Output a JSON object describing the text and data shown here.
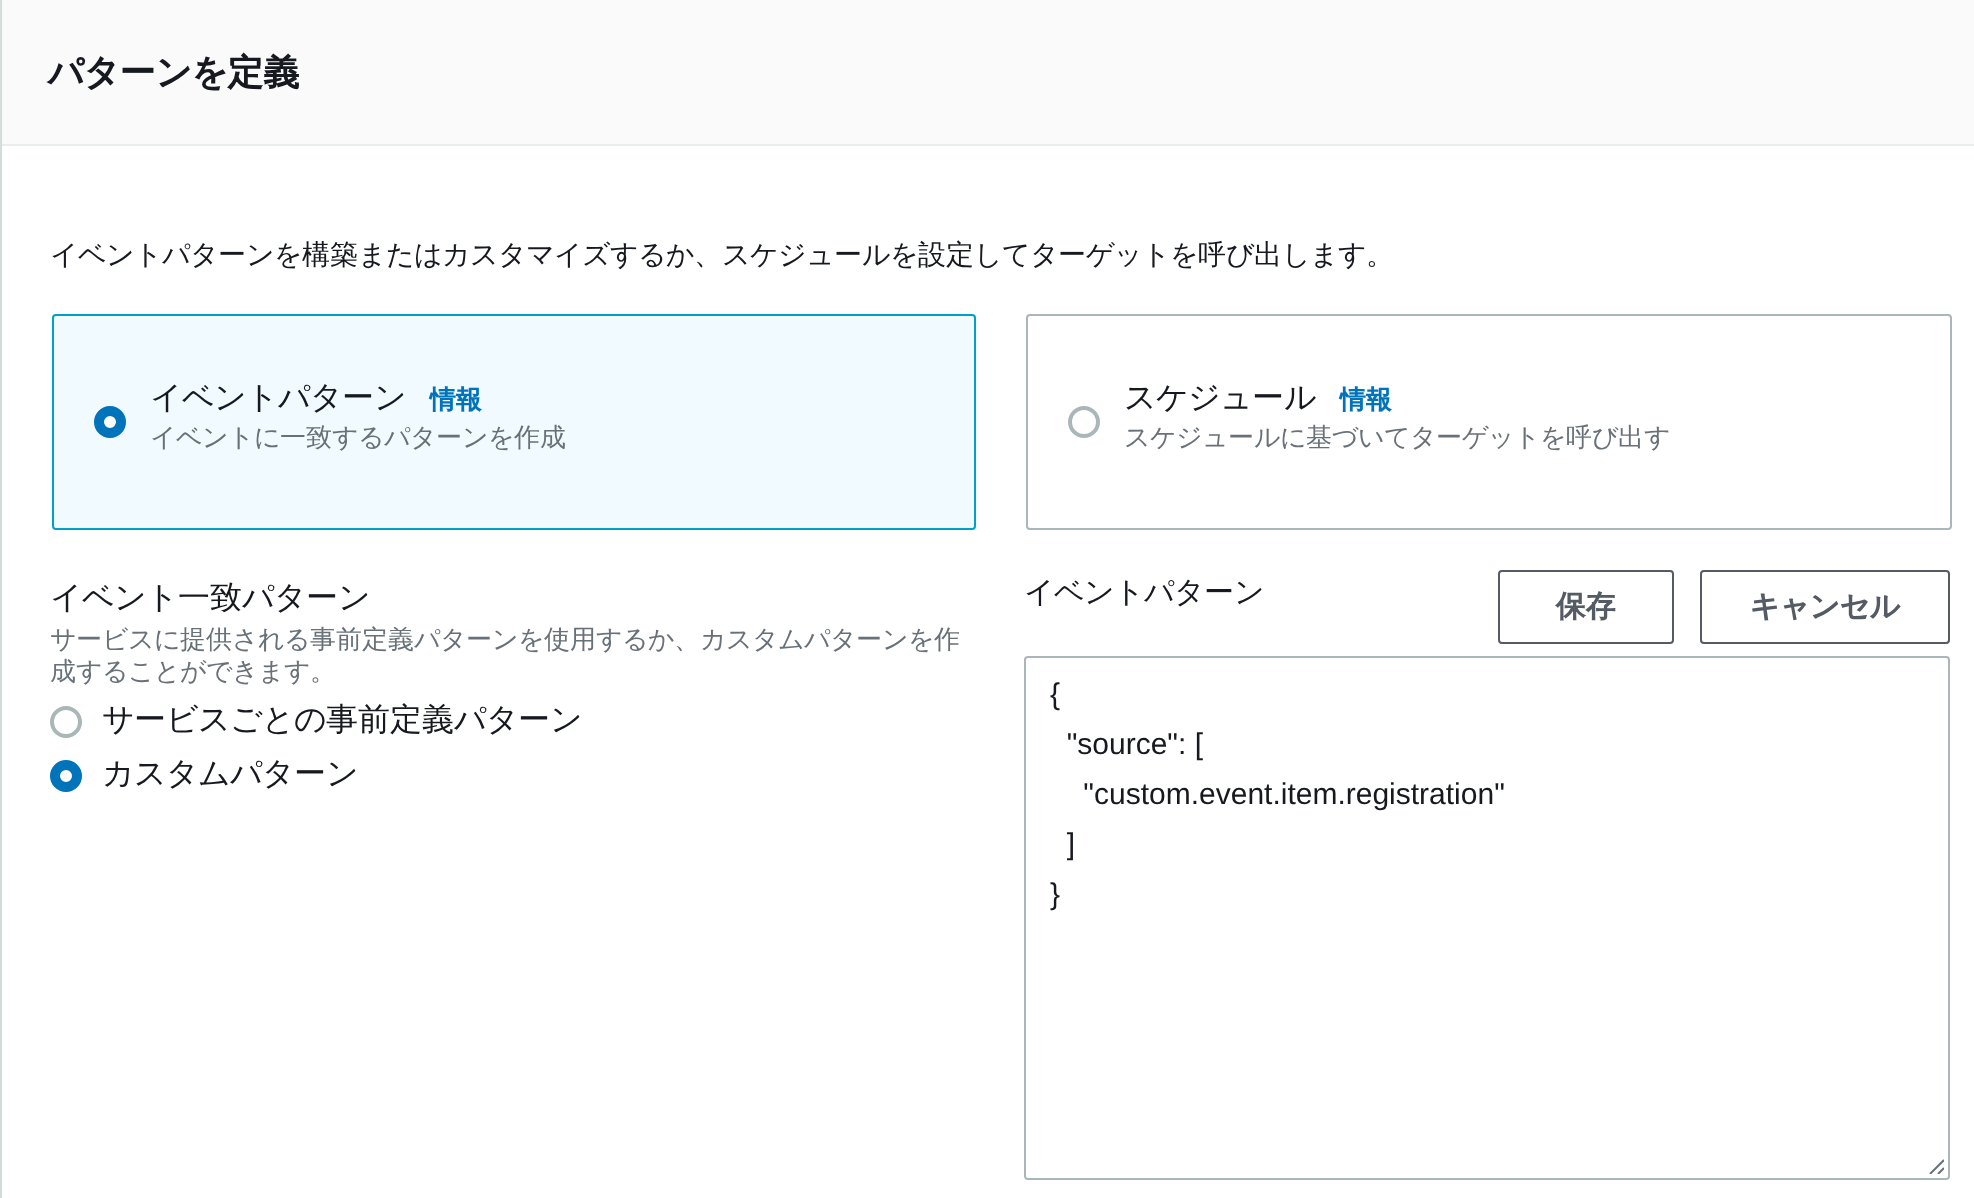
{
  "header": {
    "title": "パターンを定義"
  },
  "description": "イベントパターンを構築またはカスタマイズするか、スケジュールを設定してターゲットを呼び出します。",
  "tiles": [
    {
      "label": "イベントパターン",
      "info": "情報",
      "description": "イベントに一致するパターンを作成",
      "selected": true
    },
    {
      "label": "スケジュール",
      "info": "情報",
      "description": "スケジュールに基づいてターゲットを呼び出す",
      "selected": false
    }
  ],
  "match_section": {
    "label": "イベント一致パターン",
    "description": "サービスに提供される事前定義パターンを使用するか、カスタムパターンを作成することができます。",
    "options": [
      {
        "label": "サービスごとの事前定義パターン",
        "selected": false
      },
      {
        "label": "カスタムパターン",
        "selected": true
      }
    ]
  },
  "editor": {
    "label": "イベントパターン",
    "buttons": [
      "保存",
      "キャンセル"
    ],
    "value": "{\n  \"source\": [\n    \"custom.event.item.registration\"\n  ]\n}"
  }
}
